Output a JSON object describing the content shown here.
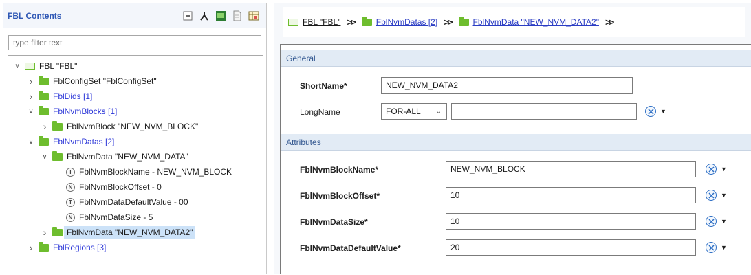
{
  "left": {
    "title": "FBL Contents",
    "filter_placeholder": "type filter text",
    "tree": [
      {
        "label": "FBL \"FBL\"",
        "blue": false,
        "icon": "module-icon",
        "chevron": "expanded",
        "level": 0
      },
      {
        "label": "FblConfigSet \"FblConfigSet\"",
        "blue": false,
        "icon": "folder-icon",
        "chevron": "collapsed",
        "level": 1
      },
      {
        "label": "FblDids [1]",
        "blue": true,
        "icon": "folder-icon",
        "chevron": "collapsed",
        "level": 1
      },
      {
        "label": "FblNvmBlocks [1]",
        "blue": true,
        "icon": "folder-icon",
        "chevron": "expanded",
        "level": 1
      },
      {
        "label": "FblNvmBlock \"NEW_NVM_BLOCK\"",
        "blue": false,
        "icon": "folder-icon",
        "chevron": "collapsed",
        "level": 2
      },
      {
        "label": "FblNvmDatas [2]",
        "blue": true,
        "icon": "folder-icon",
        "chevron": "expanded",
        "level": 1
      },
      {
        "label": "FblNvmData \"NEW_NVM_DATA\"",
        "blue": false,
        "icon": "folder-icon",
        "chevron": "expanded",
        "level": 2
      },
      {
        "label": "FblNvmBlockName - NEW_NVM_BLOCK",
        "blue": false,
        "icon": "text-param-icon",
        "glyph": "T",
        "chevron": "none",
        "level": 3
      },
      {
        "label": "FblNvmBlockOffset - 0",
        "blue": false,
        "icon": "number-param-icon",
        "glyph": "N",
        "chevron": "none",
        "level": 3
      },
      {
        "label": "FblNvmDataDefaultValue - 00",
        "blue": false,
        "icon": "text-param-icon",
        "glyph": "T",
        "chevron": "none",
        "level": 3
      },
      {
        "label": "FblNvmDataSize - 5",
        "blue": false,
        "icon": "number-param-icon",
        "glyph": "N",
        "chevron": "none",
        "level": 3
      },
      {
        "label": "FblNvmData \"NEW_NVM_DATA2\"",
        "blue": false,
        "icon": "folder-icon",
        "chevron": "collapsed",
        "level": 2,
        "selected": true
      },
      {
        "label": "FblRegions [3]",
        "blue": true,
        "icon": "folder-icon",
        "chevron": "collapsed",
        "level": 1
      }
    ]
  },
  "breadcrumb": {
    "item1": "FBL \"FBL\"",
    "item2": "FblNvmDatas [2]",
    "item3": "FblNvmData \"NEW_NVM_DATA2\""
  },
  "general": {
    "header": "General",
    "shortname_label": "ShortName*",
    "shortname_value": "NEW_NVM_DATA2",
    "longname_label": "LongName",
    "longname_lang": "FOR-ALL",
    "longname_value": ""
  },
  "attributes": {
    "header": "Attributes",
    "fields": [
      {
        "label": "FblNvmBlockName*",
        "value": "NEW_NVM_BLOCK"
      },
      {
        "label": "FblNvmBlockOffset*",
        "value": "10"
      },
      {
        "label": "FblNvmDataSize*",
        "value": "10"
      },
      {
        "label": "FblNvmDataDefaultValue*",
        "value": "20"
      }
    ]
  },
  "colors": {
    "accent_blue": "#2f58b5",
    "folder_green": "#6ebd2e",
    "section_header_bg": "#e2ebf5",
    "selection_bg": "#cce2f8"
  }
}
